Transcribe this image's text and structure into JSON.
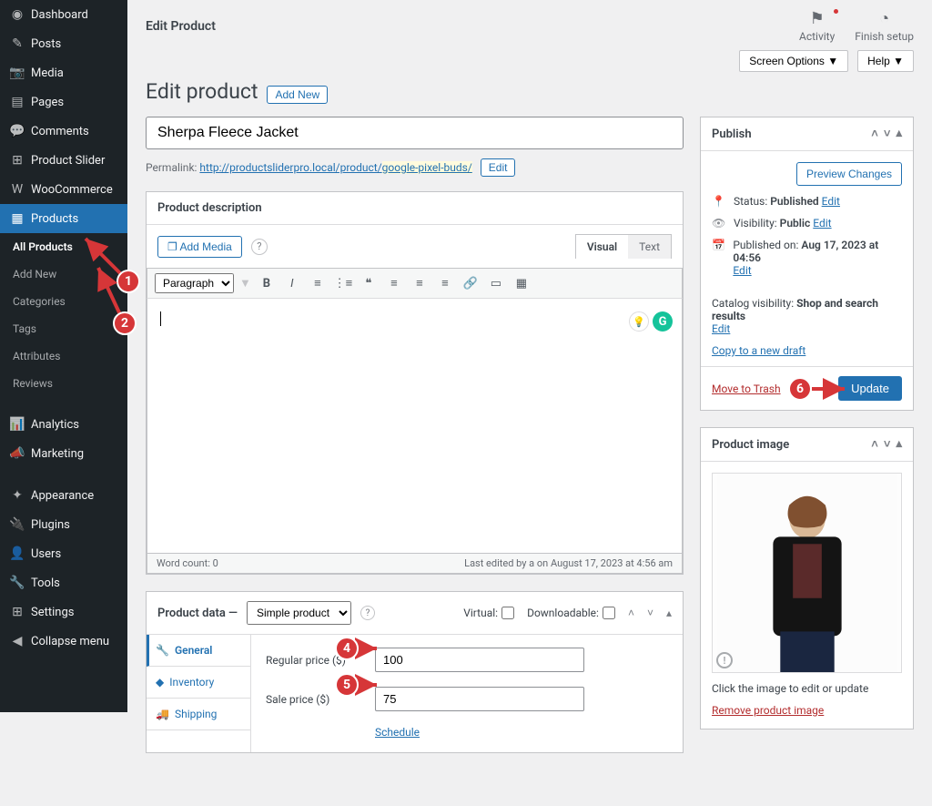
{
  "topbar": {
    "title": "Edit Product",
    "activity": "Activity",
    "finish": "Finish setup"
  },
  "optbar": {
    "screen_options": "Screen Options ▼",
    "help": "Help ▼"
  },
  "heading": {
    "title": "Edit product",
    "add_new": "Add New"
  },
  "sidebar": {
    "items": [
      {
        "label": "Dashboard",
        "icon": "◉"
      },
      {
        "label": "Posts",
        "icon": "✎"
      },
      {
        "label": "Media",
        "icon": "📷"
      },
      {
        "label": "Pages",
        "icon": "▤"
      },
      {
        "label": "Comments",
        "icon": "💬"
      },
      {
        "label": "Product Slider",
        "icon": "⊞"
      },
      {
        "label": "WooCommerce",
        "icon": "W"
      },
      {
        "label": "Products",
        "icon": "▦",
        "active": true
      },
      {
        "label": "All Products",
        "sub": true,
        "cur": true
      },
      {
        "label": "Add New",
        "sub": true
      },
      {
        "label": "Categories",
        "sub": true
      },
      {
        "label": "Tags",
        "sub": true
      },
      {
        "label": "Attributes",
        "sub": true
      },
      {
        "label": "Reviews",
        "sub": true
      },
      {
        "label": "Analytics",
        "icon": "📊"
      },
      {
        "label": "Marketing",
        "icon": "📣"
      },
      {
        "label": "Appearance",
        "icon": "✦"
      },
      {
        "label": "Plugins",
        "icon": "🔌"
      },
      {
        "label": "Users",
        "icon": "👤"
      },
      {
        "label": "Tools",
        "icon": "🔧"
      },
      {
        "label": "Settings",
        "icon": "⊞"
      },
      {
        "label": "Collapse menu",
        "icon": "◀"
      }
    ]
  },
  "product": {
    "title_value": "Sherpa Fleece Jacket",
    "permalink_label": "Permalink:",
    "permalink_base": "http://productsliderpro.local/product/",
    "permalink_slug": "google-pixel-buds/",
    "edit_btn": "Edit"
  },
  "desc": {
    "heading": "Product description",
    "add_media": "Add Media",
    "tab_visual": "Visual",
    "tab_text": "Text",
    "format": "Paragraph",
    "word_count": "Word count: 0",
    "last_edited": "Last edited by a on August 17, 2023 at 4:56 am"
  },
  "pdata": {
    "heading": "Product data —",
    "type": "Simple product",
    "virtual": "Virtual:",
    "downloadable": "Downloadable:",
    "tabs": [
      "General",
      "Inventory",
      "Shipping"
    ],
    "regular_label": "Regular price ($)",
    "regular_value": "100",
    "sale_label": "Sale price ($)",
    "sale_value": "75",
    "schedule": "Schedule"
  },
  "publish": {
    "heading": "Publish",
    "preview": "Preview Changes",
    "status_l": "Status:",
    "status_v": "Published",
    "edit": "Edit",
    "vis_l": "Visibility:",
    "vis_v": "Public",
    "pub_l": "Published on:",
    "pub_v": "Aug 17, 2023 at 04:56",
    "cat_l": "Catalog visibility:",
    "cat_v": "Shop and search results",
    "copy": "Copy to a new draft",
    "trash": "Move to Trash",
    "update": "Update"
  },
  "pimg": {
    "heading": "Product image",
    "note": "Click the image to edit or update",
    "remove": "Remove product image"
  },
  "annotations": {
    "n1": "1",
    "n2": "2",
    "n4": "4",
    "n5": "5",
    "n6": "6"
  }
}
